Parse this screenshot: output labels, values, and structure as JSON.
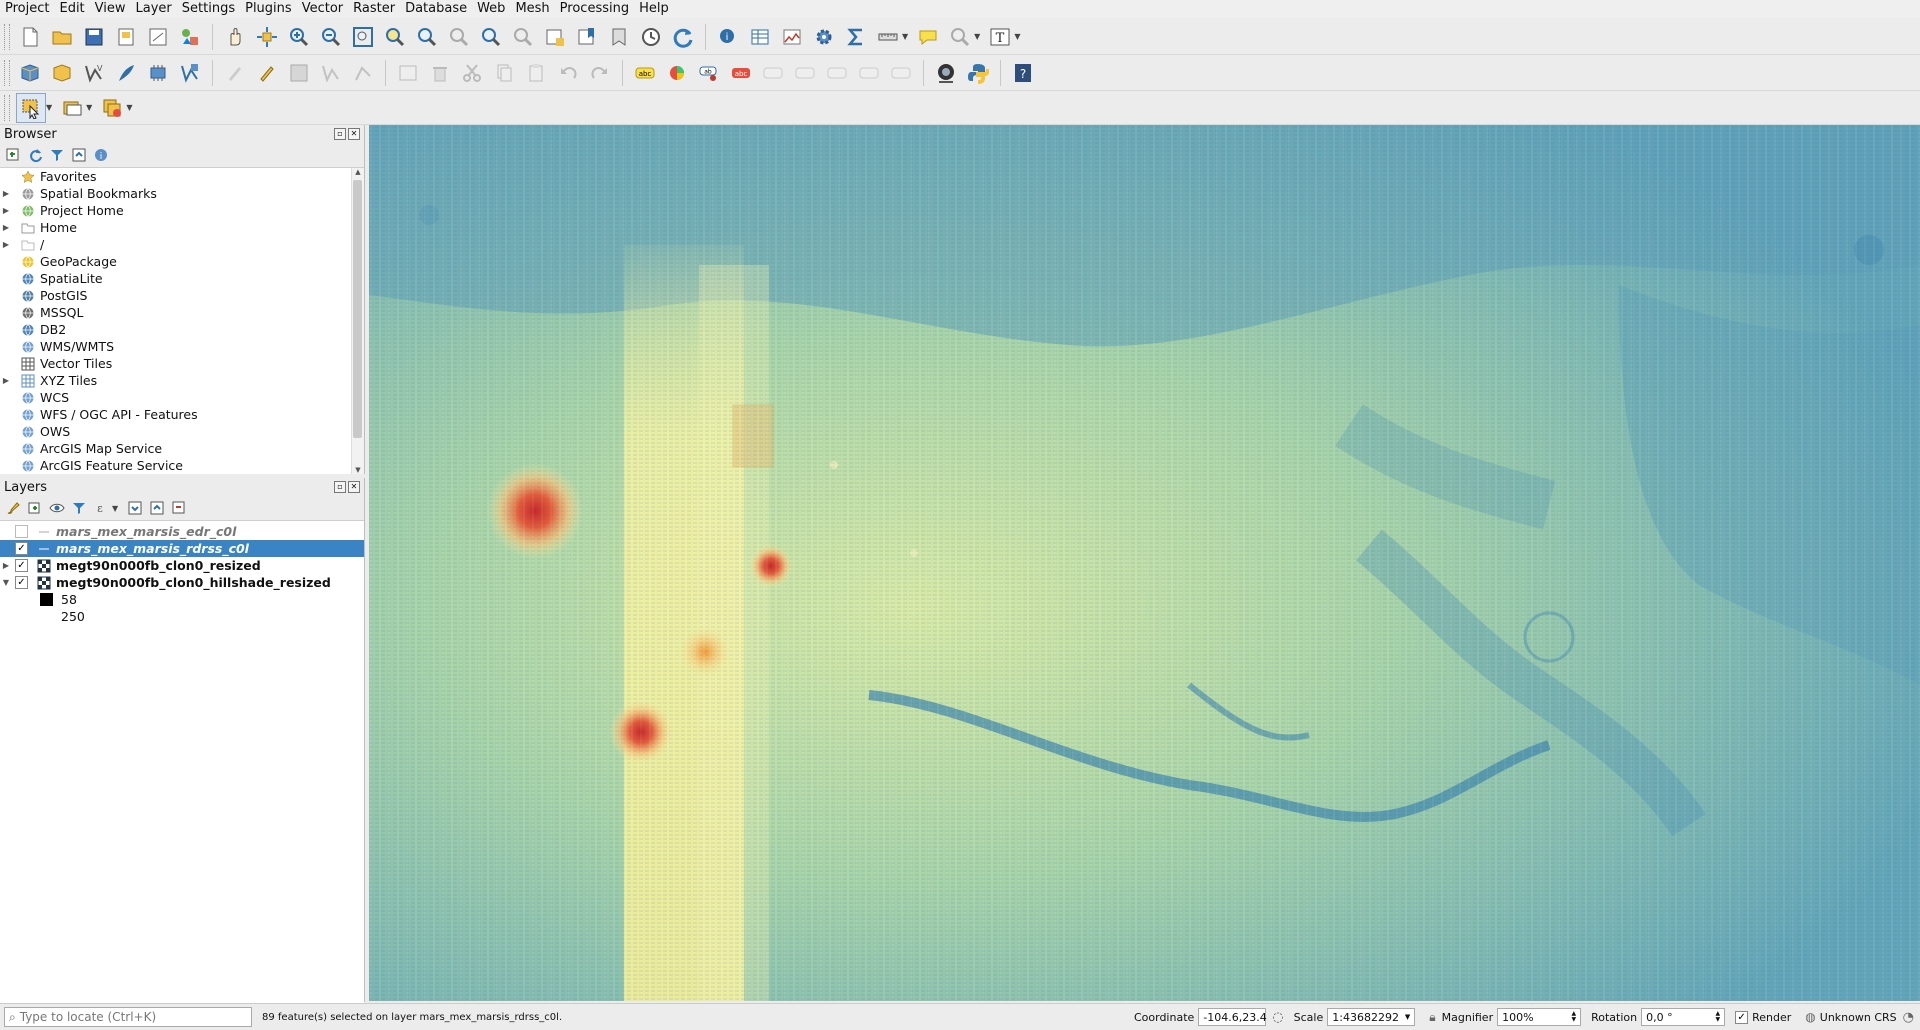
{
  "menubar": {
    "items": [
      "Project",
      "Edit",
      "View",
      "Layer",
      "Settings",
      "Plugins",
      "Vector",
      "Raster",
      "Database",
      "Web",
      "Mesh",
      "Processing",
      "Help"
    ]
  },
  "browser": {
    "title": "Browser",
    "items": [
      {
        "label": "Favorites",
        "icon": "star-icon",
        "expandable": false
      },
      {
        "label": "Spatial Bookmarks",
        "icon": "bookmark-icon",
        "expandable": true
      },
      {
        "label": "Project Home",
        "icon": "project-home-icon",
        "expandable": true
      },
      {
        "label": "Home",
        "icon": "home-folder-icon",
        "expandable": true
      },
      {
        "label": "/",
        "icon": "folder-icon",
        "expandable": true
      },
      {
        "label": "GeoPackage",
        "icon": "geopackage-icon",
        "expandable": false
      },
      {
        "label": "SpatiaLite",
        "icon": "spatialite-icon",
        "expandable": false
      },
      {
        "label": "PostGIS",
        "icon": "postgis-icon",
        "expandable": false
      },
      {
        "label": "MSSQL",
        "icon": "mssql-icon",
        "expandable": false
      },
      {
        "label": "DB2",
        "icon": "db2-icon",
        "expandable": false
      },
      {
        "label": "WMS/WMTS",
        "icon": "wms-icon",
        "expandable": false
      },
      {
        "label": "Vector Tiles",
        "icon": "vector-tiles-icon",
        "expandable": false
      },
      {
        "label": "XYZ Tiles",
        "icon": "xyz-tiles-icon",
        "expandable": true
      },
      {
        "label": "WCS",
        "icon": "wcs-icon",
        "expandable": false
      },
      {
        "label": "WFS / OGC API - Features",
        "icon": "wfs-icon",
        "expandable": false
      },
      {
        "label": "OWS",
        "icon": "ows-icon",
        "expandable": false
      },
      {
        "label": "ArcGIS Map Service",
        "icon": "arcgis-map-icon",
        "expandable": false
      },
      {
        "label": "ArcGIS Feature Service",
        "icon": "arcgis-feature-icon",
        "expandable": false
      }
    ]
  },
  "layers": {
    "title": "Layers",
    "items": [
      {
        "label": "mars_mex_marsis_edr_c0l",
        "checked": false,
        "selected": false,
        "style": "italic"
      },
      {
        "label": "mars_mex_marsis_rdrss_c0l",
        "checked": true,
        "selected": true,
        "style": "italic"
      },
      {
        "label": "megt90n000fb_clon0_resized",
        "checked": true,
        "selected": false,
        "style": "bold"
      },
      {
        "label": "megt90n000fb_clon0_hillshade_resized",
        "checked": true,
        "selected": false,
        "style": "bold"
      }
    ],
    "legend": [
      "58",
      "250"
    ]
  },
  "status": {
    "locator_placeholder": "Type to locate (Ctrl+K)",
    "message": "89 feature(s) selected on layer mars_mex_marsis_rdrss_c0l.",
    "coordinate_label": "Coordinate",
    "coordinate_value": "-104.6,23.4",
    "scale_label": "Scale",
    "scale_value": "1:43682292",
    "magnifier_label": "Magnifier",
    "magnifier_value": "100%",
    "rotation_label": "Rotation",
    "rotation_value": "0,0 °",
    "render_label": "Render",
    "crs_label": "Unknown CRS"
  },
  "colors": {
    "selection": "#3a84c6",
    "map_low": "#4f93b7",
    "map_mid": "#a9d7a4",
    "map_high": "#f4f2a0",
    "hotspot": "#d32f2f"
  }
}
